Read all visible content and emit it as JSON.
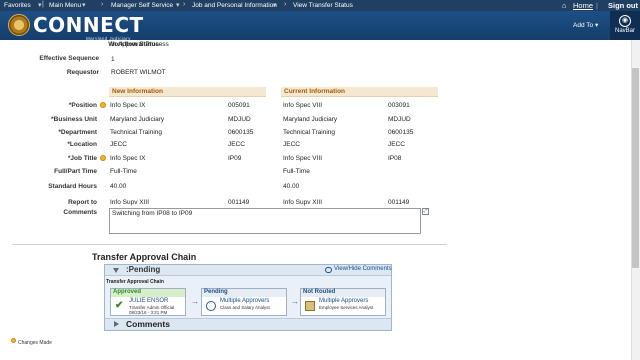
{
  "topnav": {
    "crumbs": [
      "Favorites",
      "Main Menu",
      "Manager Self Service",
      "Job and Personal Information",
      "View Transfer Status"
    ],
    "home": "Home",
    "signout": "Sign out"
  },
  "banner": {
    "logo_text": "CONNECT",
    "logo_sub": "Maryland Judiciary",
    "add_to": "Add To",
    "navbar": "NavBar"
  },
  "fields": {
    "workflow_status_label": "Workflow Status",
    "workflow_status_value": "In Approval Process",
    "effective_sequence_label": "Effective Sequence",
    "effective_sequence_value": "1",
    "requestor_label": "Requestor",
    "requestor_value": "ROBERT WILMOT"
  },
  "columns": {
    "new_header": "New Information",
    "current_header": "Current Information"
  },
  "rows": [
    {
      "label": "*Position",
      "changed": true,
      "new_val": "Info Spec IX",
      "new_code": "005091",
      "cur_val": "Info Spec VIII",
      "cur_code": "003091"
    },
    {
      "label": "*Business Unit",
      "changed": false,
      "new_val": "Maryland Judiciary",
      "new_code": "MDJUD",
      "cur_val": "Maryland Judiciary",
      "cur_code": "MDJUD"
    },
    {
      "label": "*Department",
      "changed": false,
      "new_val": "Technical Training",
      "new_code": "0600135",
      "cur_val": "Technical Training",
      "cur_code": "0600135"
    },
    {
      "label": "*Location",
      "changed": false,
      "new_val": "JECC",
      "new_code": "JECC",
      "cur_val": "JECC",
      "cur_code": "JECC"
    },
    {
      "label": "*Job Title",
      "changed": true,
      "new_val": "Info Spec IX",
      "new_code": "IP09",
      "cur_val": "Info Spec VIII",
      "cur_code": "IP08"
    },
    {
      "label": "Full/Part Time",
      "changed": false,
      "new_val": "Full-Time",
      "new_code": "",
      "cur_val": "Full-Time",
      "cur_code": ""
    },
    {
      "label": "Standard Hours",
      "changed": false,
      "new_val": "40.00",
      "new_code": "",
      "cur_val": "40.00",
      "cur_code": ""
    },
    {
      "label": "Report to",
      "changed": false,
      "new_val": "Info Supv XIII",
      "new_code": "001149",
      "cur_val": "Info Supv XIII",
      "cur_code": "001149"
    }
  ],
  "comments": {
    "label": "Comments",
    "value": "Switching from IP08 to IP09"
  },
  "chain": {
    "title": "Transfer Approval Chain",
    "pending_title": ":Pending",
    "view_hide": "View/Hide Comments",
    "sub_caption": "Transfer Approval Chain",
    "steps": [
      {
        "status": "Approved",
        "name": "JULIE ENSOR",
        "line2": "Transfer Admin Official",
        "line3": "08/23/16 - 3:21 PM"
      },
      {
        "status": "Pending",
        "name": "Multiple Approvers",
        "line2": "Class and Salary Analyst",
        "line3": ""
      },
      {
        "status": "Not Routed",
        "name": "Multiple Approvers",
        "line2": "Employee Services Analyst",
        "line3": ""
      }
    ],
    "comments_title": "Comments"
  },
  "legend": "Changes Made",
  "colors": {
    "nav_dark": "#1f3f63",
    "header_orange": "#a35a0b",
    "approved_green": "#2e8b2e",
    "link_blue": "#1a4f8a"
  }
}
